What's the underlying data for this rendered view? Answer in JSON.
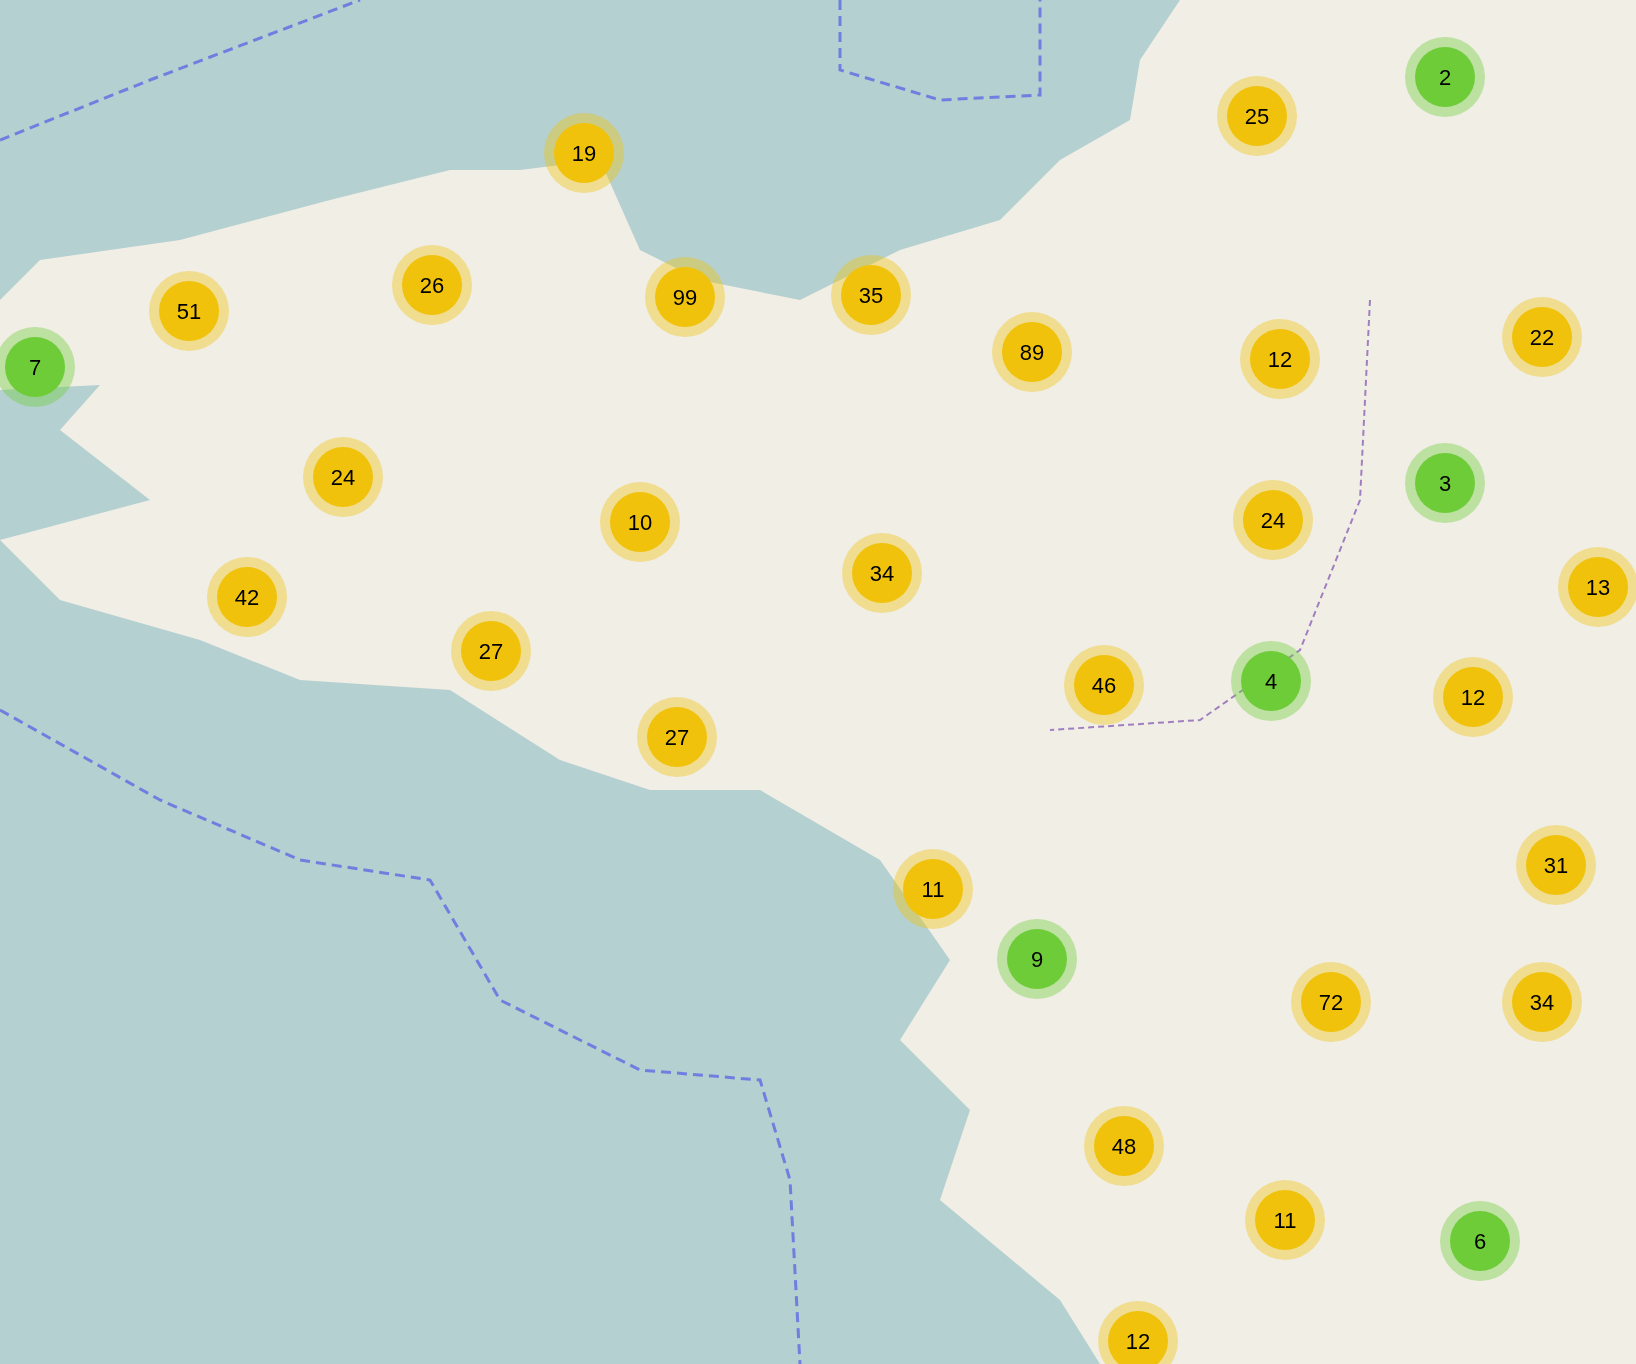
{
  "clusters": [
    {
      "count": "7",
      "color": "#6ecc39"
    },
    {
      "count": "19",
      "color": "#f0c20c"
    },
    {
      "count": "2",
      "color": "#6ecc39"
    },
    {
      "count": "25",
      "color": "#f0c20c"
    },
    {
      "count": "51",
      "color": "#f0c20c"
    },
    {
      "count": "26",
      "color": "#f0c20c"
    },
    {
      "count": "99",
      "color": "#f0c20c"
    },
    {
      "count": "35",
      "color": "#f0c20c"
    },
    {
      "count": "89",
      "color": "#f0c20c"
    },
    {
      "count": "12",
      "color": "#f0c20c"
    },
    {
      "count": "22",
      "color": "#f0c20c"
    },
    {
      "count": "24",
      "color": "#f0c20c"
    },
    {
      "count": "10",
      "color": "#f0c20c"
    },
    {
      "count": "3",
      "color": "#6ecc39"
    },
    {
      "count": "24",
      "color": "#f0c20c"
    },
    {
      "count": "34",
      "color": "#f0c20c"
    },
    {
      "count": "13",
      "color": "#f0c20c"
    },
    {
      "count": "42",
      "color": "#f0c20c"
    },
    {
      "count": "27",
      "color": "#f0c20c"
    },
    {
      "count": "46",
      "color": "#f0c20c"
    },
    {
      "count": "4",
      "color": "#6ecc39"
    },
    {
      "count": "12",
      "color": "#f0c20c"
    },
    {
      "count": "27",
      "color": "#f0c20c"
    },
    {
      "count": "31",
      "color": "#f0c20c"
    },
    {
      "count": "11",
      "color": "#f0c20c"
    },
    {
      "count": "9",
      "color": "#6ecc39"
    },
    {
      "count": "72",
      "color": "#f0c20c"
    },
    {
      "count": "34",
      "color": "#f0c20c"
    },
    {
      "count": "48",
      "color": "#f0c20c"
    },
    {
      "count": "11",
      "color": "#f0c20c"
    },
    {
      "count": "6",
      "color": "#6ecc39"
    },
    {
      "count": "12",
      "color": "#f0c20c"
    }
  ]
}
